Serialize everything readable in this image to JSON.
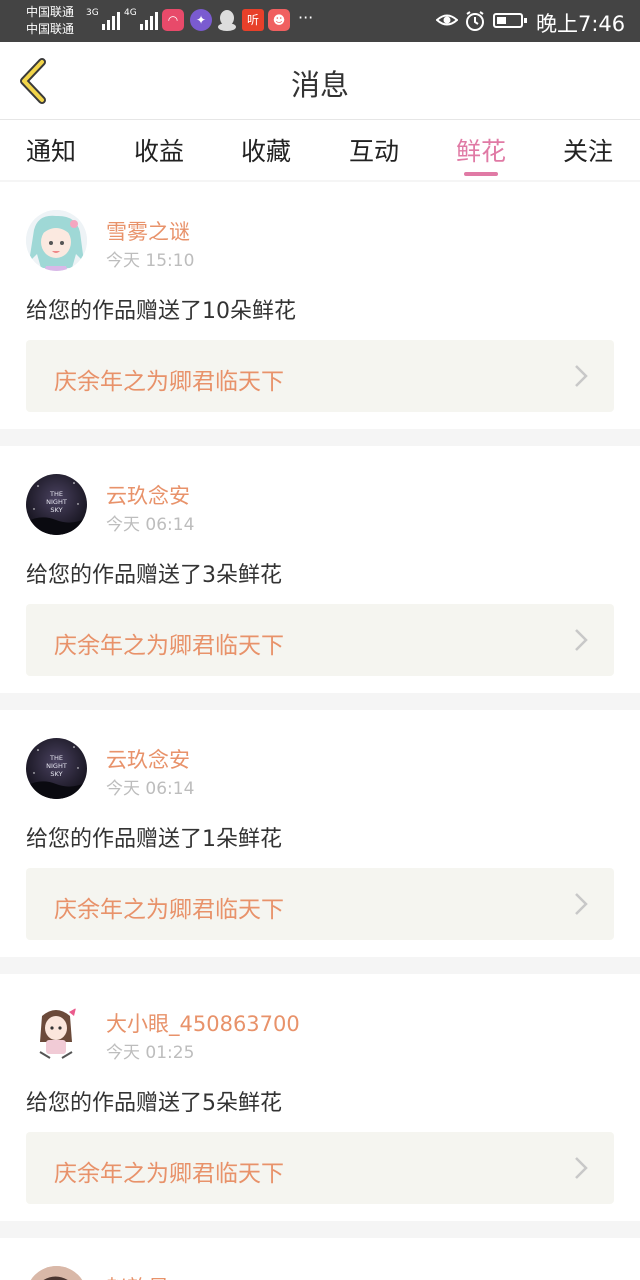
{
  "status_bar": {
    "carrier1": "中国联通",
    "carrier2": "中国联通",
    "network1": "3G",
    "network2": "4G",
    "listen_icon_text": "听",
    "more": "···",
    "time": "晚上7:46",
    "battery_level": 0.4
  },
  "nav": {
    "title": "消息",
    "back_icon": "chevron-left-icon"
  },
  "tabs": [
    {
      "label": "通知",
      "active": false
    },
    {
      "label": "收益",
      "active": false
    },
    {
      "label": "收藏",
      "active": false
    },
    {
      "label": "互动",
      "active": false
    },
    {
      "label": "鲜花",
      "active": true
    },
    {
      "label": "关注",
      "active": false
    }
  ],
  "colors": {
    "accent_pink": "#e07aa5",
    "name_orange": "#e8926a",
    "work_bg": "#f5f5f0",
    "statusbar_bg": "#444444"
  },
  "items": [
    {
      "user": "雪雾之谜",
      "time": "今天 15:10",
      "message": "给您的作品赠送了10朵鲜花",
      "work": "庆余年之为卿君临天下",
      "avatar": "anime-avatar"
    },
    {
      "user": "云玖念安",
      "time": "今天 06:14",
      "message": "给您的作品赠送了3朵鲜花",
      "work": "庆余年之为卿君临天下",
      "avatar": "night-sky-avatar",
      "avatar_text": [
        "THE",
        "NIGHT",
        "SKY"
      ]
    },
    {
      "user": "云玖念安",
      "time": "今天 06:14",
      "message": "给您的作品赠送了1朵鲜花",
      "work": "庆余年之为卿君临天下",
      "avatar": "night-sky-avatar",
      "avatar_text": [
        "THE",
        "NIGHT",
        "SKY"
      ]
    },
    {
      "user": "大小眼_450863700",
      "time": "今天 01:25",
      "message": "给您的作品赠送了5朵鲜花",
      "work": "庆余年之为卿君临天下",
      "avatar": "cartoon-girl-avatar"
    },
    {
      "user": "赵韵昊",
      "avatar": "photo-avatar"
    }
  ]
}
